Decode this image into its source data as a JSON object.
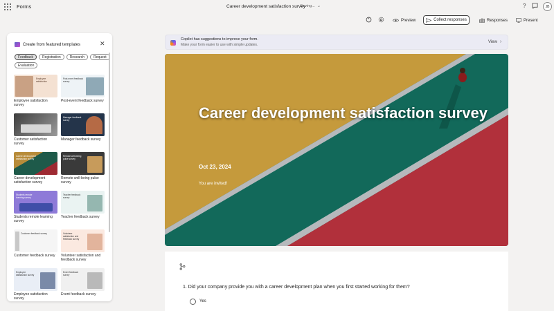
{
  "app": {
    "name": "Forms"
  },
  "header": {
    "title": "Career development satisfaction survey",
    "separator": "-",
    "status": "Saving...",
    "avatar_initials": "JB"
  },
  "toolbar": {
    "preview": "Preview",
    "collect": "Collect responses",
    "responses": "Responses",
    "present": "Present"
  },
  "panel": {
    "title": "Create from featured templates",
    "filters": [
      "Feedback",
      "Registration",
      "Research",
      "Request",
      "Evaluation"
    ],
    "templates": [
      {
        "label": "Employee satisfaction survey",
        "thumb_text": "Employee satisfaction",
        "color": "#f4e1d2"
      },
      {
        "label": "Post-event feedback survey",
        "thumb_text": "Post-event feedback survey",
        "color": "#eef3f6"
      },
      {
        "label": "Customer satisfaction survey",
        "thumb_text": "",
        "color": "#6b6b6b"
      },
      {
        "label": "Manager feedback survey",
        "thumb_text": "Manager feedback survey",
        "color": "#24344a"
      },
      {
        "label": "Career development satisfaction survey",
        "thumb_text": "Career development satisfaction survey",
        "color": "#1e5a4a"
      },
      {
        "label": "Remote well-being pulse survey",
        "thumb_text": "Remote well-being pulse survey",
        "color": "#3a3a3a"
      },
      {
        "label": "Students remote learning survey",
        "thumb_text": "Students remote learning survey",
        "color": "#8e7ad8"
      },
      {
        "label": "Teacher feedback survey",
        "thumb_text": "Teacher feedback survey",
        "color": "#eaf3f2"
      },
      {
        "label": "Customer feedback survey",
        "thumb_text": "Customer feedback survey",
        "color": "#f5f5f5"
      },
      {
        "label": "Volunteer satisfaction and feedback survey",
        "thumb_text": "Volunteer satisfaction and feedback survey",
        "color": "#fbe9e0"
      },
      {
        "label": "Employee satisfaction survey",
        "thumb_text": "Employee satisfaction survey",
        "color": "#e9eef6"
      },
      {
        "label": "Event feedback survey",
        "thumb_text": "Event feedback survey",
        "color": "#f0f0f0"
      }
    ]
  },
  "copilot": {
    "title": "Copilot has suggestions to improve your form.",
    "subtitle": "Make your form easier to use with simple updates.",
    "action": "View"
  },
  "hero": {
    "title": "Career development satisfaction survey",
    "date": "Oct 23, 2024",
    "invite": "You are invited!"
  },
  "question": {
    "text": "1. Did your company provide you with a career development plan when you first started working for them?",
    "options": [
      "Yes"
    ]
  },
  "icons": {
    "waffle": "app-launcher-icon",
    "help": "?",
    "chat": "💬",
    "close": "✕",
    "chevron": "›"
  },
  "colors": {
    "accent": "#5b5fc7",
    "hero_yellow": "#c59a3c",
    "hero_green": "#12695a",
    "hero_red": "#b1303b"
  }
}
